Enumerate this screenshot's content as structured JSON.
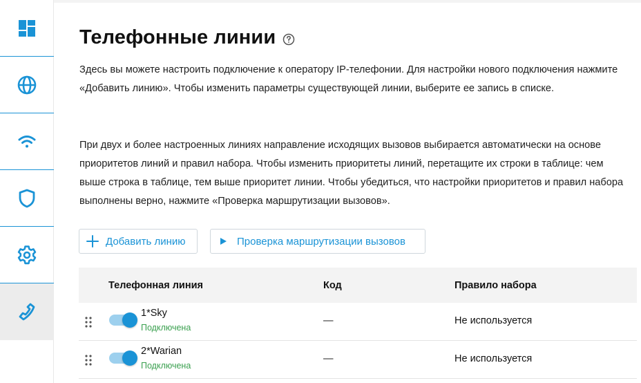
{
  "sidebar": {
    "items": [
      {
        "icon": "dashboard-icon",
        "active": false
      },
      {
        "icon": "globe-icon",
        "active": false
      },
      {
        "icon": "wifi-icon",
        "active": false
      },
      {
        "icon": "shield-icon",
        "active": false
      },
      {
        "icon": "gear-icon",
        "active": false
      },
      {
        "icon": "phone-icon",
        "active": true
      }
    ]
  },
  "colors": {
    "accent": "#1a93d6",
    "status_ok": "#3aa04f"
  },
  "page": {
    "title": "Телефонные линии",
    "paragraph1": "Здесь вы можете настроить подключение к оператору IP-телефонии. Для настройки нового подключения нажмите «Добавить линию». Чтобы изменить параметры существующей линии, выберите ее запись в списке.",
    "paragraph2": "При двух и более настроенных линиях направление исходящих вызовов выбирается автоматически на основе приоритетов линий и правил набора. Чтобы изменить приоритеты линий, перетащите их строки в таблице: чем выше строка в таблице, тем выше приоритет линии. Чтобы убедиться, что настройки приоритетов и правил набора выполнены верно, нажмите «Проверка маршрутизации вызовов»."
  },
  "actions": {
    "add_label": "Добавить линию",
    "route_label": "Проверка маршрутизации вызовов"
  },
  "table": {
    "headers": {
      "line": "Телефонная линия",
      "code": "Код",
      "rule": "Правило набора"
    },
    "rows": [
      {
        "name": "1*Sky",
        "status": "Подключена",
        "enabled": true,
        "code": "—",
        "rule": "Не используется"
      },
      {
        "name": "2*Warian",
        "status": "Подключена",
        "enabled": true,
        "code": "—",
        "rule": "Не используется"
      }
    ]
  }
}
